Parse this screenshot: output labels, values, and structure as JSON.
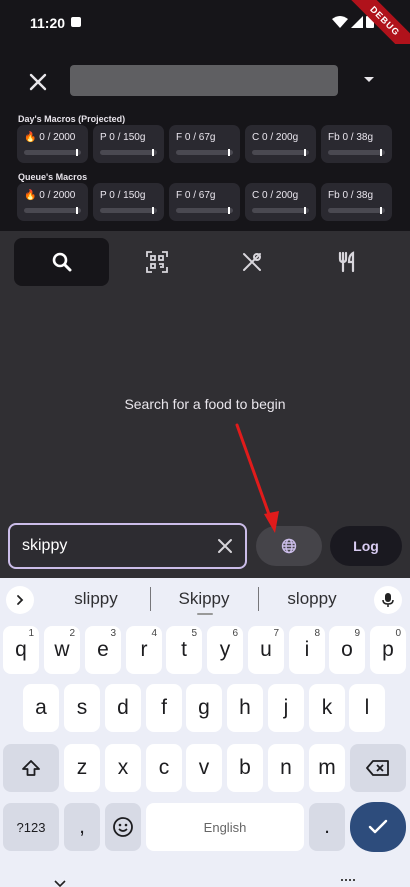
{
  "status_bar": {
    "time": "11:20",
    "debug_label": "DEBUG"
  },
  "macros": {
    "days_label": "Day's Macros (Projected)",
    "queue_label": "Queue's Macros",
    "day": [
      {
        "text": "🔥 0 / 2000",
        "progress": 0
      },
      {
        "text": "P 0 / 150g",
        "progress": 0
      },
      {
        "text": "F 0 / 67g",
        "progress": 0
      },
      {
        "text": "C 0 / 200g",
        "progress": 0
      },
      {
        "text": "Fb 0 / 38g",
        "progress": 0
      }
    ],
    "queue": [
      {
        "text": "🔥 0 / 2000",
        "progress": 0
      },
      {
        "text": "P 0 / 150g",
        "progress": 0
      },
      {
        "text": "F 0 / 67g",
        "progress": 0
      },
      {
        "text": "C 0 / 200g",
        "progress": 0
      },
      {
        "text": "Fb 0 / 38g",
        "progress": 0
      }
    ]
  },
  "tabs": [
    {
      "icon": "search-icon",
      "active": true
    },
    {
      "icon": "barcode-scan-icon",
      "active": false
    },
    {
      "icon": "food-utensils-cross-icon",
      "active": false
    },
    {
      "icon": "restaurant-icon",
      "active": false
    }
  ],
  "empty_message": "Search for a food to begin",
  "search": {
    "value": "skippy"
  },
  "log_label": "Log",
  "keyboard": {
    "suggestions": [
      "slippy",
      "Skippy",
      "sloppy"
    ],
    "row1": [
      [
        "q",
        "1"
      ],
      [
        "w",
        "2"
      ],
      [
        "e",
        "3"
      ],
      [
        "r",
        "4"
      ],
      [
        "t",
        "5"
      ],
      [
        "y",
        "6"
      ],
      [
        "u",
        "7"
      ],
      [
        "i",
        "8"
      ],
      [
        "o",
        "9"
      ],
      [
        "p",
        "0"
      ]
    ],
    "row2": [
      "a",
      "s",
      "d",
      "f",
      "g",
      "h",
      "j",
      "k",
      "l"
    ],
    "row3": [
      "z",
      "x",
      "c",
      "v",
      "b",
      "n",
      "m"
    ],
    "symbols_label": "?123",
    "comma_label": ",",
    "space_label": "English",
    "period_label": "."
  },
  "colors": {
    "accent": "#cbbde9",
    "enter": "#2d4c7c",
    "debug": "#b0121b"
  }
}
